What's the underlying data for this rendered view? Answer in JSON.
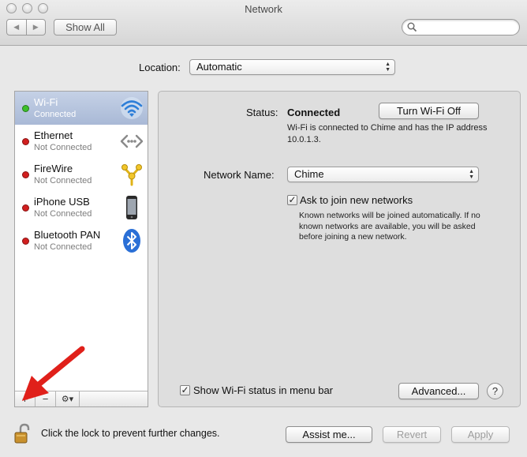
{
  "window": {
    "title": "Network"
  },
  "toolbar": {
    "show_all_label": "Show All",
    "search_placeholder": ""
  },
  "location": {
    "label": "Location:",
    "value": "Automatic"
  },
  "services": [
    {
      "name": "Wi-Fi",
      "status": "Connected",
      "state": "connected",
      "icon": "wifi-icon",
      "selected": true
    },
    {
      "name": "Ethernet",
      "status": "Not Connected",
      "state": "disconnected",
      "icon": "ethernet-icon"
    },
    {
      "name": "FireWire",
      "status": "Not Connected",
      "state": "disconnected",
      "icon": "firewire-icon"
    },
    {
      "name": "iPhone USB",
      "status": "Not Connected",
      "state": "disconnected",
      "icon": "iphone-icon"
    },
    {
      "name": "Bluetooth PAN",
      "status": "Not Connected",
      "state": "disconnected",
      "icon": "bluetooth-icon"
    }
  ],
  "sidebar_footer": {
    "add": "+",
    "remove": "−",
    "action": "⚙▾"
  },
  "detail": {
    "status_label": "Status:",
    "status_value": "Connected",
    "turn_off_label": "Turn Wi-Fi Off",
    "status_desc": "Wi-Fi is connected to Chime and has the IP address 10.0.1.3.",
    "network_name_label": "Network Name:",
    "network_name_value": "Chime",
    "ask_join_label": "Ask to join new networks",
    "ask_join_checked": true,
    "ask_join_desc": "Known networks will be joined automatically. If no known networks are available, you will be asked before joining a new network.",
    "show_status_label": "Show Wi-Fi status in menu bar",
    "show_status_checked": true,
    "advanced_label": "Advanced...",
    "help_label": "?"
  },
  "footer": {
    "lock_text": "Click the lock to prevent further changes.",
    "assist_label": "Assist me...",
    "revert_label": "Revert",
    "apply_label": "Apply"
  },
  "colors": {
    "selection": "#a9b9d6",
    "status_connected": "#3cbf2a",
    "status_disconnected": "#d11f1f",
    "arrow_annotation": "#e0201a"
  }
}
